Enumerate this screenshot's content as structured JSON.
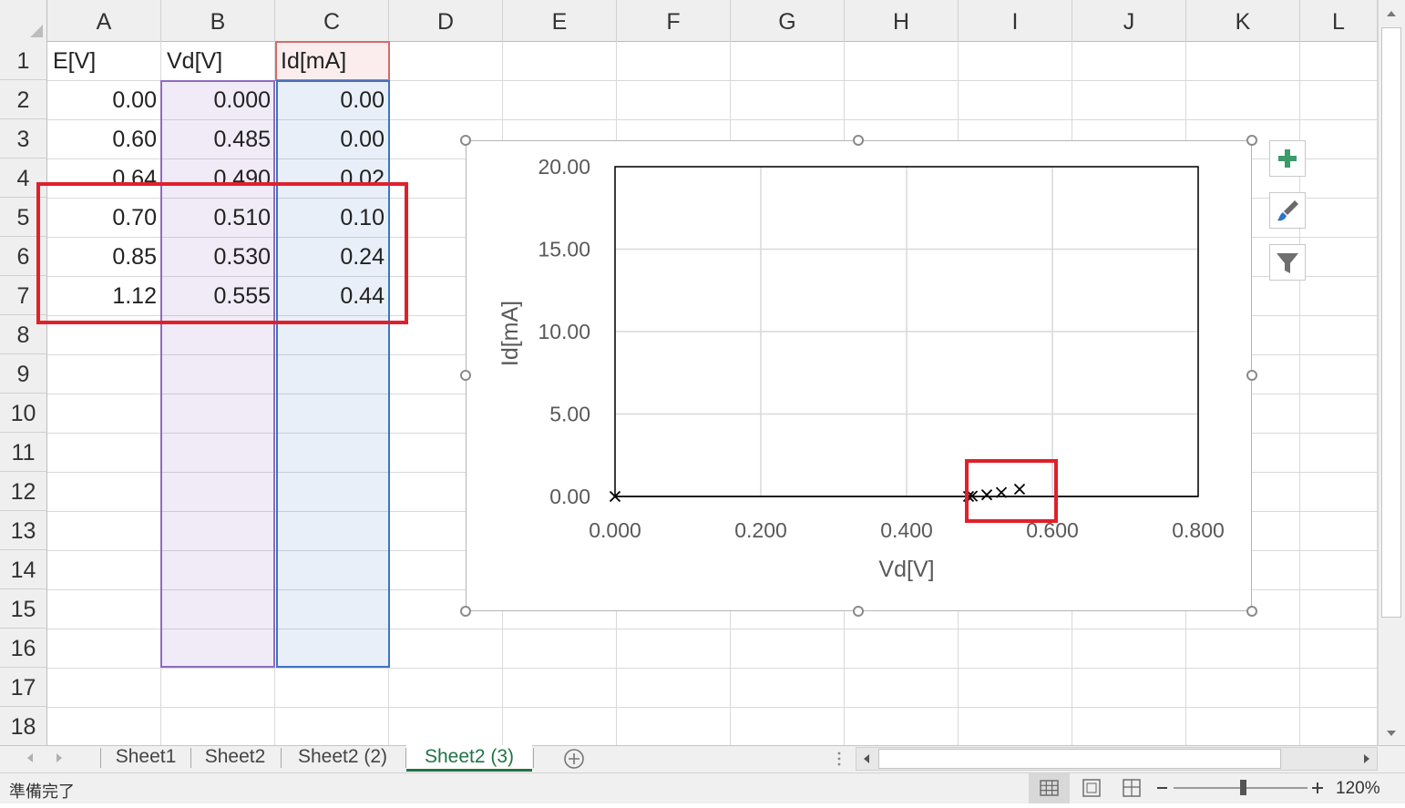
{
  "columns": [
    "A",
    "B",
    "C",
    "D",
    "E",
    "F",
    "G",
    "H",
    "I",
    "J",
    "K",
    "L"
  ],
  "rows": [
    "1",
    "2",
    "3",
    "4",
    "5",
    "6",
    "7",
    "8",
    "9",
    "10",
    "11",
    "12",
    "13",
    "14",
    "15",
    "16",
    "17",
    "18"
  ],
  "headers": {
    "a": "E[V]",
    "b": "Vd[V]",
    "c": "Id[mA]"
  },
  "table": [
    [
      "0.00",
      "0.000",
      "0.00"
    ],
    [
      "0.60",
      "0.485",
      "0.00"
    ],
    [
      "0.64",
      "0.490",
      "0.02"
    ],
    [
      "0.70",
      "0.510",
      "0.10"
    ],
    [
      "0.85",
      "0.530",
      "0.24"
    ],
    [
      "1.12",
      "0.555",
      "0.44"
    ]
  ],
  "chart_data": {
    "type": "scatter",
    "title": "",
    "xlabel": "Vd[V]",
    "ylabel": "Id[mA]",
    "xlim": [
      0,
      0.8
    ],
    "ylim": [
      0,
      20
    ],
    "x_ticks": [
      "0.000",
      "0.200",
      "0.400",
      "0.600",
      "0.800"
    ],
    "y_ticks": [
      "0.00",
      "5.00",
      "10.00",
      "15.00",
      "20.00"
    ],
    "marker": "x",
    "grid": true,
    "series": [
      {
        "points": [
          [
            0.0,
            0.0
          ],
          [
            0.485,
            0.0
          ],
          [
            0.49,
            0.02
          ],
          [
            0.51,
            0.1
          ],
          [
            0.53,
            0.24
          ],
          [
            0.555,
            0.44
          ]
        ]
      }
    ]
  },
  "sheets": {
    "tabs": [
      "Sheet1",
      "Sheet2",
      "Sheet2 (2)",
      "Sheet2 (3)"
    ],
    "active": "Sheet2 (3)"
  },
  "status": {
    "ready": "準備完了",
    "zoom": "120%"
  },
  "colors": {
    "selection_red": "#e0202a",
    "excel_green": "#217346"
  }
}
